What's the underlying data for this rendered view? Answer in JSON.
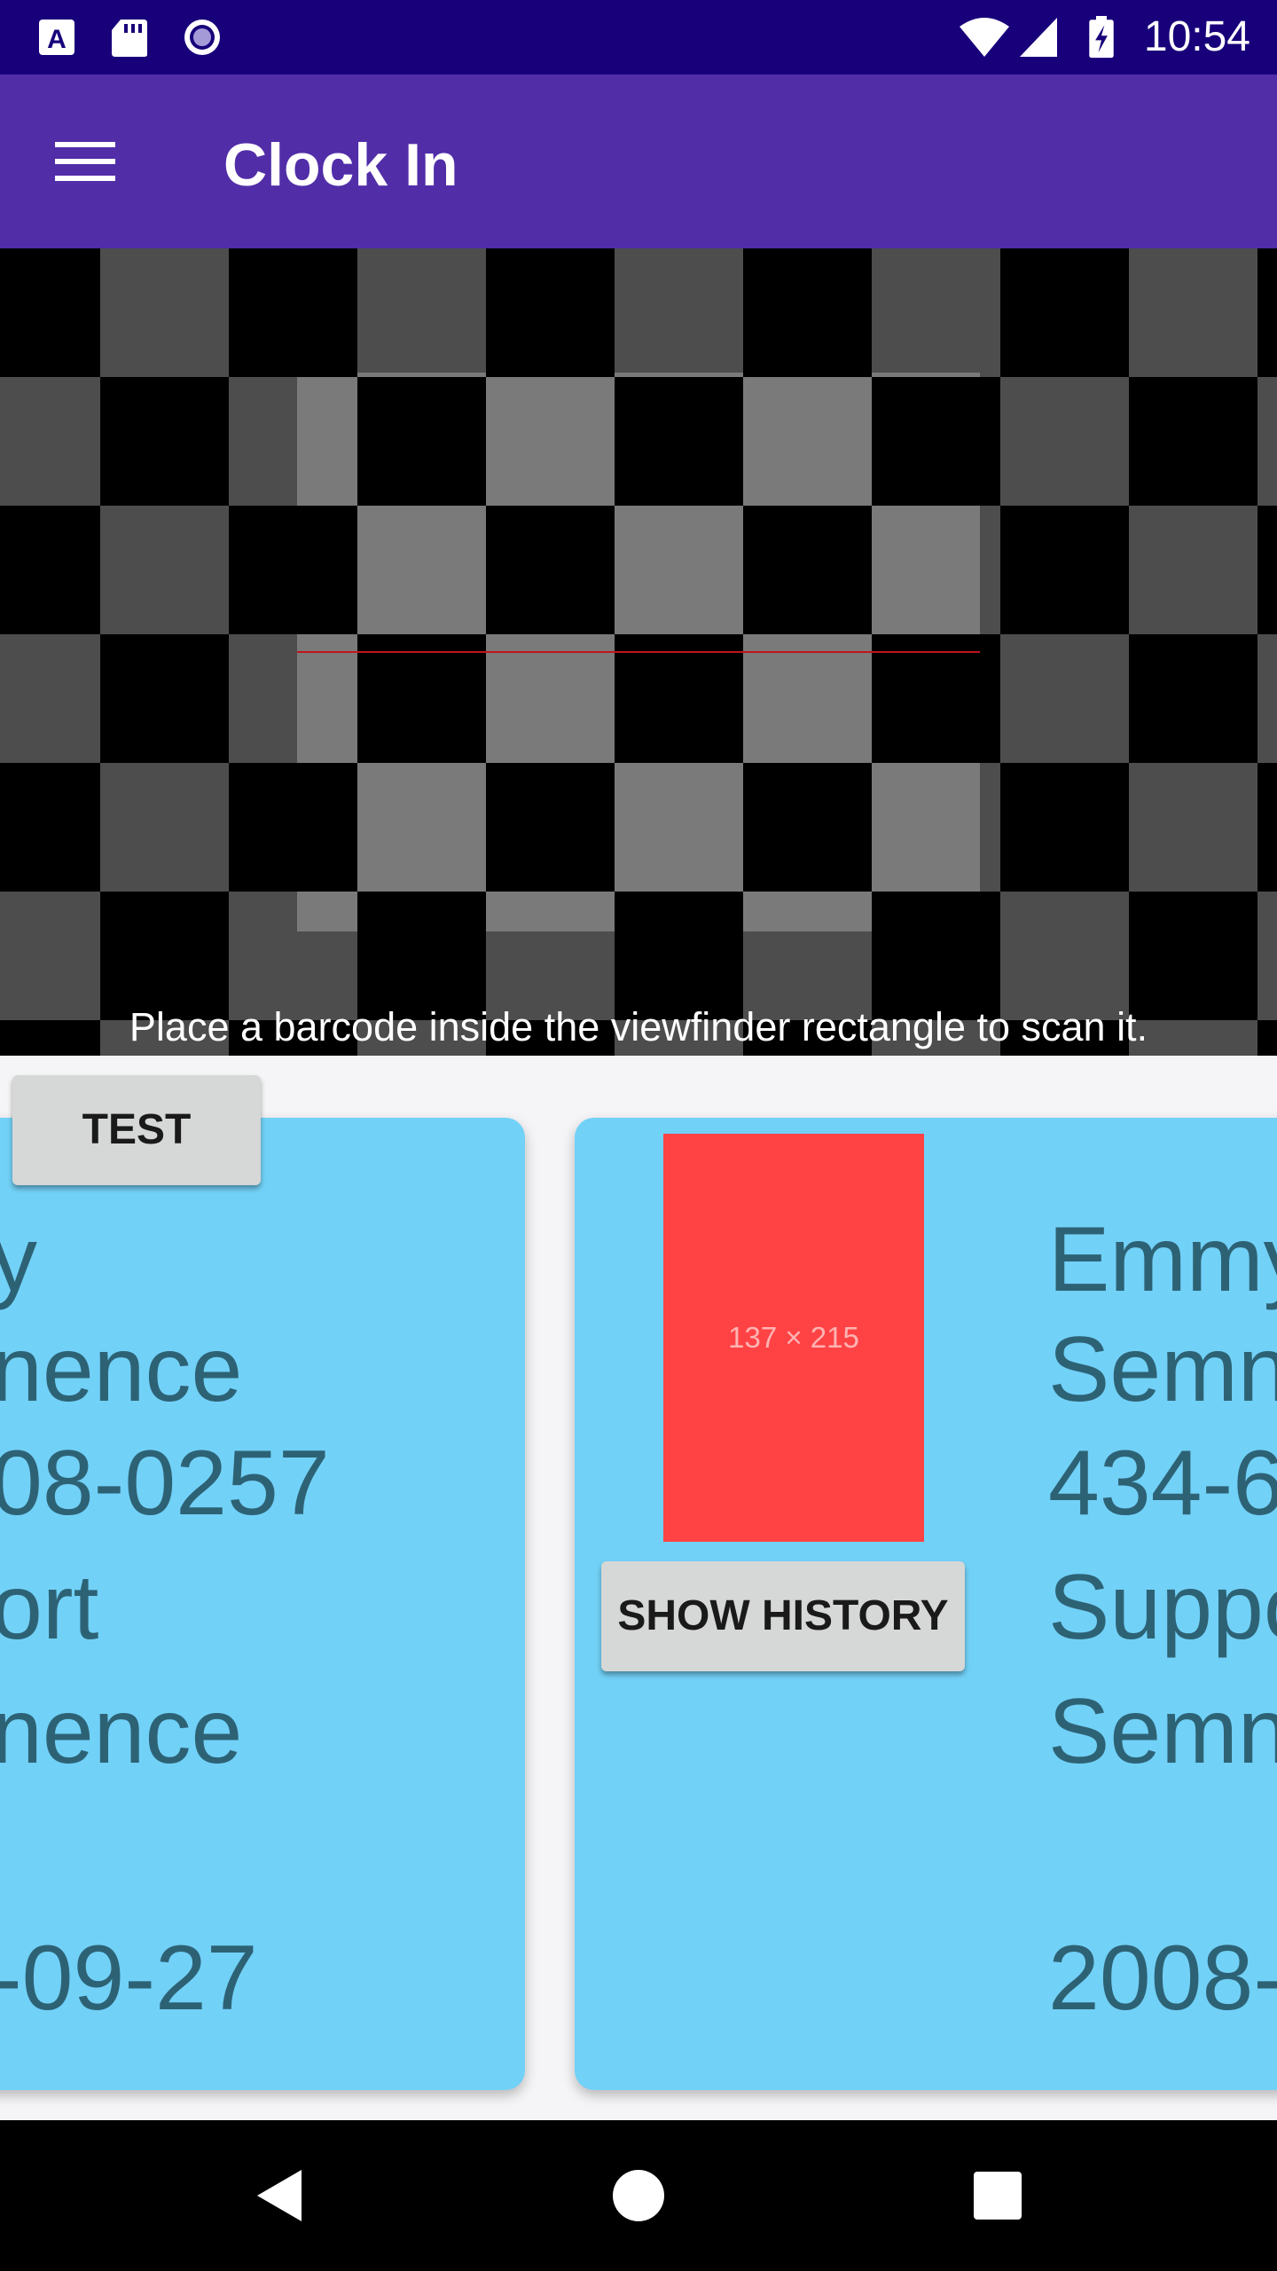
{
  "status_bar": {
    "time": "10:54",
    "left_icons": [
      "text-a-notification-icon",
      "sd-card-icon",
      "radio-circle-icon"
    ],
    "right_icons": [
      "wifi-icon",
      "cell-signal-icon",
      "battery-charging-icon"
    ]
  },
  "app_bar": {
    "title": "Clock In",
    "menu_icon": "hamburger-menu-icon"
  },
  "scanner": {
    "hint": "Place a barcode inside the viewfinder rectangle to scan it.",
    "laser_color": "#c0141c"
  },
  "test_button": {
    "label": "TEST"
  },
  "cards": [
    {
      "lines": [
        "y",
        "nence",
        "08-0257",
        "ort",
        "nence",
        "",
        "-09-27"
      ]
    },
    {
      "photo_placeholder": "137 × 215",
      "history_button": "SHOW HISTORY",
      "lines": [
        "Emmy",
        "Semn",
        "434-6",
        "Suppo",
        "Semn",
        "",
        "2008-"
      ]
    }
  ],
  "nav_bar": {
    "icons": [
      "back-icon",
      "home-icon",
      "recents-icon"
    ]
  },
  "colors": {
    "status_bar": "#18007a",
    "app_bar": "#512da8",
    "card": "#72d1f7",
    "card_text": "#2d6275",
    "photo": "#ff4345",
    "button": "#d6d7d7"
  }
}
